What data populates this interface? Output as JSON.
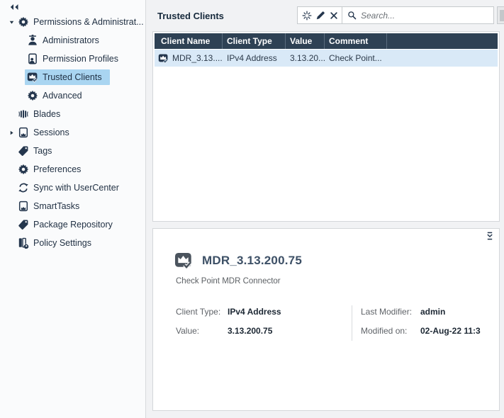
{
  "sidebar": {
    "items": [
      {
        "label": "Permissions & Administrat...",
        "icon": "gear",
        "level": 0,
        "expanded": true,
        "selected": false
      },
      {
        "label": "Administrators",
        "icon": "administrator",
        "level": 1,
        "selected": false
      },
      {
        "label": "Permission Profiles",
        "icon": "permission-profile",
        "level": 1,
        "selected": false
      },
      {
        "label": "Trusted Clients",
        "icon": "trusted-client",
        "level": 1,
        "selected": true
      },
      {
        "label": "Advanced",
        "icon": "gear",
        "level": 1,
        "selected": false
      },
      {
        "label": "Blades",
        "icon": "blades",
        "level": 0,
        "selected": false
      },
      {
        "label": "Sessions",
        "icon": "session",
        "level": 0,
        "collapsed": true,
        "selected": false
      },
      {
        "label": "Tags",
        "icon": "tag",
        "level": 0,
        "selected": false
      },
      {
        "label": "Preferences",
        "icon": "gear",
        "level": 0,
        "selected": false
      },
      {
        "label": "Sync with UserCenter",
        "icon": "sync",
        "level": 0,
        "selected": false
      },
      {
        "label": "SmartTasks",
        "icon": "session",
        "level": 0,
        "selected": false
      },
      {
        "label": "Package Repository",
        "icon": "tag",
        "level": 0,
        "selected": false
      },
      {
        "label": "Policy Settings",
        "icon": "policy-settings",
        "level": 0,
        "selected": false
      }
    ]
  },
  "main": {
    "title": "Trusted Clients",
    "toolbar_icons": [
      "new-sparkle",
      "edit-pencil",
      "delete-x"
    ],
    "search": {
      "placeholder": "Search..."
    },
    "table": {
      "columns": [
        "Client Name",
        "Client Type",
        "Value",
        "Comment"
      ],
      "rows": [
        {
          "icon": "trusted-client",
          "client_name": "MDR_3.13....",
          "client_type": "IPv4 Address",
          "value": "3.13.20...",
          "comment": "Check Point..."
        }
      ]
    }
  },
  "details": {
    "icon": "trusted-client-badge",
    "title": "MDR_3.13.200.75",
    "subtitle": "Check Point MDR Connector",
    "fields": {
      "left": [
        {
          "label": "Client Type:",
          "value": "IPv4 Address"
        },
        {
          "label": "Value:",
          "value": "3.13.200.75"
        }
      ],
      "right": [
        {
          "label": "Last Modifier:",
          "value": "admin"
        },
        {
          "label": "Modified on:",
          "value": "02-Aug-22 11:3"
        }
      ]
    }
  },
  "colors": {
    "header_navy": "#2e4154",
    "selection_blue": "#a9d5f1",
    "row_selection_blue": "#d9e9f7",
    "icon_navy": "#24364d"
  }
}
